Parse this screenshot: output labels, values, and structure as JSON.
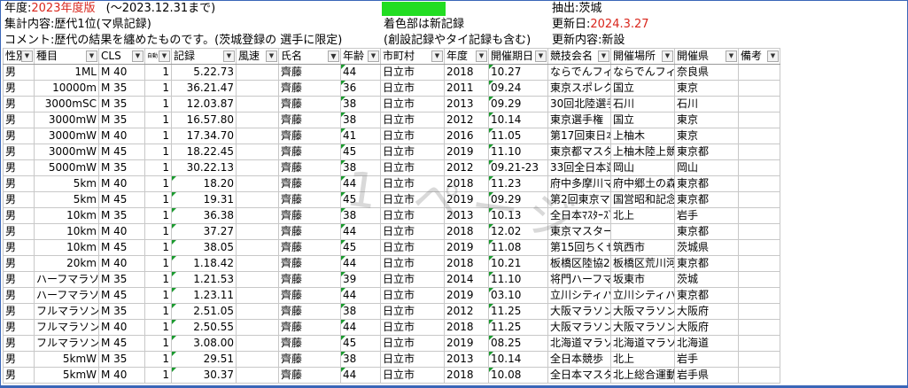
{
  "header": {
    "year_label": "年度:",
    "year_value": "2023年度版",
    "year_range": "(～2023.12.31まで)",
    "summary": "集計内容:歴代1位(マ県記録)",
    "comment": "コメント:歴代の結果を纏めたものです。(茨城登録の 選手に限定)",
    "colored_note": "着色部は新記録",
    "colored_note2": "(創設記録やタイ記録も含む)",
    "extract": "抽出:茨城",
    "updated_label": "更新日:",
    "updated_value": "2024.3.27",
    "update_content": "更新内容:新設",
    "swatch_color": "#22dd22"
  },
  "columns": [
    "性別",
    "種目",
    "CLS",
    "自動",
    "記録",
    "風速",
    "氏名",
    "年齢",
    "市町村",
    "年度",
    "開催期日",
    "競技会名",
    "開催場所",
    "開催県",
    "備考"
  ],
  "watermark": "1 ページ",
  "rows": [
    {
      "sex": "男",
      "event": "1ML",
      "cls": "M 40",
      "auto": "1",
      "record": "5.22.73",
      "wind": "",
      "name": "齊藤",
      "age": "44",
      "city": "日立市",
      "year": "2018",
      "date": "10.27",
      "meet": "ならでんフィールド",
      "place": "ならでんフィールド",
      "pref": "奈良県"
    },
    {
      "sex": "男",
      "event": "10000m",
      "cls": "M 35",
      "auto": "1",
      "record": "36.21.47",
      "wind": "",
      "name": "齊藤",
      "age": "36",
      "city": "日立市",
      "year": "2011",
      "date": "09.24",
      "meet": "東京スポレク祭",
      "place": "国立",
      "pref": "東京"
    },
    {
      "sex": "男",
      "event": "3000mSC",
      "cls": "M 35",
      "auto": "1",
      "record": "12.03.87",
      "wind": "",
      "name": "齊藤",
      "age": "38",
      "city": "日立市",
      "year": "2013",
      "date": "09.29",
      "meet": "30回北陸選手権",
      "place": "石川",
      "pref": "石川"
    },
    {
      "sex": "男",
      "event": "3000mW",
      "cls": "M 35",
      "auto": "1",
      "record": "16.57.80",
      "wind": "",
      "name": "齊藤",
      "age": "38",
      "city": "日立市",
      "year": "2012",
      "date": "10.14",
      "meet": "東京選手権",
      "place": "国立",
      "pref": "東京"
    },
    {
      "sex": "男",
      "event": "3000mW",
      "cls": "M 40",
      "auto": "1",
      "record": "17.34.70",
      "wind": "",
      "name": "齊藤",
      "age": "41",
      "city": "日立市",
      "year": "2016",
      "date": "11.05",
      "meet": "第17回東日本選手権",
      "place": "上柚木",
      "pref": "東京"
    },
    {
      "sex": "男",
      "event": "3000mW",
      "cls": "M 45",
      "auto": "1",
      "record": "18.22.45",
      "wind": "",
      "name": "齊藤",
      "age": "45",
      "city": "日立市",
      "year": "2019",
      "date": "11.10",
      "meet": "東京都マスターズ陸上",
      "place": "上柚木陸上競技場",
      "pref": "東京都"
    },
    {
      "sex": "男",
      "event": "5000mW",
      "cls": "M 35",
      "auto": "1",
      "record": "30.22.13",
      "wind": "",
      "name": "齊藤",
      "age": "38",
      "city": "日立市",
      "year": "2012",
      "date": "09.21-23",
      "meet": "33回全日本選手権",
      "place": "岡山",
      "pref": "岡山"
    },
    {
      "sex": "男",
      "event": "5km",
      "cls": "M 40",
      "auto": "1",
      "record": "18.20",
      "wind": "",
      "name": "齊藤",
      "age": "44",
      "city": "日立市",
      "year": "2018",
      "date": "11.23",
      "meet": "府中多摩川マラソン",
      "place": "府中郷土の森",
      "pref": "東京都"
    },
    {
      "sex": "男",
      "event": "5km",
      "cls": "M 45",
      "auto": "1",
      "record": "19.31",
      "wind": "",
      "name": "齊藤",
      "age": "45",
      "city": "日立市",
      "year": "2019",
      "date": "09.29",
      "meet": "第2回東京マスターズロード",
      "place": "国営昭和記念公園",
      "pref": "東京都"
    },
    {
      "sex": "男",
      "event": "10km",
      "cls": "M 35",
      "auto": "1",
      "record": "36.38",
      "wind": "",
      "name": "齊藤",
      "age": "38",
      "city": "日立市",
      "year": "2013",
      "date": "10.13",
      "meet": "全日本ﾏｽﾀｰｽﾞ選手権",
      "place": "北上",
      "pref": "岩手"
    },
    {
      "sex": "男",
      "event": "10km",
      "cls": "M 40",
      "auto": "1",
      "record": "37.27",
      "wind": "",
      "name": "齊藤",
      "age": "44",
      "city": "日立市",
      "year": "2018",
      "date": "12.02",
      "meet": "東京マスターズロードレース",
      "place": "",
      "pref": "東京都"
    },
    {
      "sex": "男",
      "event": "10km",
      "cls": "M 45",
      "auto": "1",
      "record": "38.05",
      "wind": "",
      "name": "齊藤",
      "age": "45",
      "city": "日立市",
      "year": "2019",
      "date": "11.08",
      "meet": "第15回ちくせいマラソン",
      "place": "筑西市",
      "pref": "茨城県"
    },
    {
      "sex": "男",
      "event": "20km",
      "cls": "M 40",
      "auto": "1",
      "record": "1.18.42",
      "wind": "",
      "name": "齊藤",
      "age": "44",
      "city": "日立市",
      "year": "2018",
      "date": "10.21",
      "meet": "板橋区陸協20kmロードレース",
      "place": "板橋区荒川河川敷コース",
      "pref": "東京都"
    },
    {
      "sex": "男",
      "event": "ハーフマラソン",
      "cls": "M 35",
      "auto": "1",
      "record": "1.21.53",
      "wind": "",
      "name": "齊藤",
      "age": "39",
      "city": "日立市",
      "year": "2014",
      "date": "11.10",
      "meet": "将門ハーフマラソン",
      "place": "坂東市",
      "pref": "茨城"
    },
    {
      "sex": "男",
      "event": "ハーフマラソン",
      "cls": "M 45",
      "auto": "1",
      "record": "1.23.11",
      "wind": "",
      "name": "齊藤",
      "age": "44",
      "city": "日立市",
      "year": "2019",
      "date": "03.10",
      "meet": "立川シティハーフマラソン",
      "place": "立川シティハーフマラソン",
      "pref": "東京都"
    },
    {
      "sex": "男",
      "event": "フルマラソン",
      "cls": "M 35",
      "auto": "1",
      "record": "2.51.05",
      "wind": "",
      "name": "齊藤",
      "age": "38",
      "city": "日立市",
      "year": "2012",
      "date": "11.25",
      "meet": "大阪マラソン",
      "place": "大阪マラソン競争路",
      "pref": "大阪府"
    },
    {
      "sex": "男",
      "event": "フルマラソン",
      "cls": "M 40",
      "auto": "1",
      "record": "2.50.55",
      "wind": "",
      "name": "齊藤",
      "age": "44",
      "city": "日立市",
      "year": "2018",
      "date": "11.25",
      "meet": "大阪マラソン",
      "place": "大阪マラソン競争路",
      "pref": "大阪府"
    },
    {
      "sex": "男",
      "event": "フルマラソン",
      "cls": "M 45",
      "auto": "1",
      "record": "3.08.00",
      "wind": "",
      "name": "齊藤",
      "age": "45",
      "city": "日立市",
      "year": "2019",
      "date": "08.25",
      "meet": "北海道マラソン2019",
      "place": "北海道マラソンコース",
      "pref": "北海道"
    },
    {
      "sex": "男",
      "event": "5kmW",
      "cls": "M 35",
      "auto": "1",
      "record": "29.51",
      "wind": "",
      "name": "齊藤",
      "age": "38",
      "city": "日立市",
      "year": "2013",
      "date": "10.14",
      "meet": "全日本競歩",
      "place": "北上",
      "pref": "岩手"
    },
    {
      "sex": "男",
      "event": "5kmW",
      "cls": "M 40",
      "auto": "1",
      "record": "30.37",
      "wind": "",
      "name": "齊藤",
      "age": "44",
      "city": "日立市",
      "year": "2018",
      "date": "10.08",
      "meet": "全日本マスターズ競歩",
      "place": "北上総合運動公園",
      "pref": "岩手県"
    }
  ]
}
